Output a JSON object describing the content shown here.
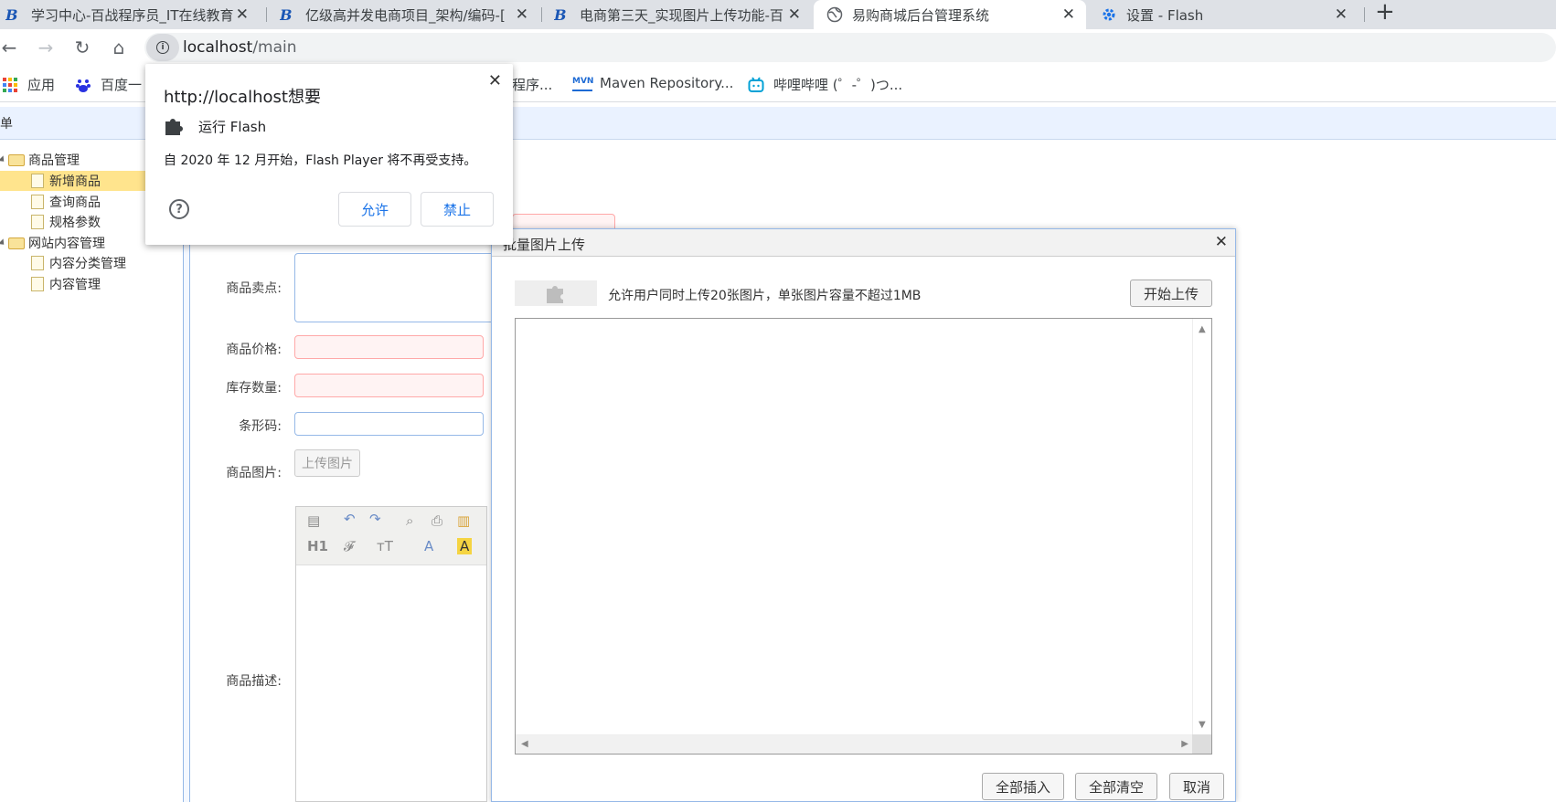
{
  "browser": {
    "tabs": [
      {
        "title": "学习中心-百战程序员_IT在线教育",
        "icon": "brand-e-icon"
      },
      {
        "title": "亿级高并发电商项目_架构/编码-[",
        "icon": "brand-e-icon"
      },
      {
        "title": "电商第三天_实现图片上传功能-百",
        "icon": "brand-e-icon"
      },
      {
        "title": "易购商城后台管理系统",
        "icon": "globe-icon"
      },
      {
        "title": "设置 - Flash",
        "icon": "gear-icon"
      }
    ],
    "new_tab": "+",
    "close_glyph": "✕",
    "url_host": "localhost",
    "url_path": "/main",
    "bookmarks": [
      {
        "label": "应用",
        "icon": "apps-grid-icon"
      },
      {
        "label": "百度一",
        "icon": "baidu-icon"
      },
      {
        "label": "程序...",
        "icon": "bookmark-icon"
      },
      {
        "label": "Maven Repository...",
        "icon": "maven-icon"
      },
      {
        "label": "哔哩哔哩 (゜-゜)つ...",
        "icon": "bilibili-icon"
      }
    ],
    "accent_color": "#1a73e8"
  },
  "page": {
    "menu_title": "菜单",
    "tree": [
      {
        "label": "商品管理",
        "type": "folder",
        "level": 0
      },
      {
        "label": "新增商品",
        "type": "file",
        "level": 1,
        "selected": true
      },
      {
        "label": "查询商品",
        "type": "file",
        "level": 1
      },
      {
        "label": "规格参数",
        "type": "file",
        "level": 1
      },
      {
        "label": "网站内容管理",
        "type": "folder",
        "level": 0
      },
      {
        "label": "内容分类管理",
        "type": "file",
        "level": 1
      },
      {
        "label": "内容管理",
        "type": "file",
        "level": 1
      }
    ],
    "form": {
      "sell_point_label": "商品卖点:",
      "price_label": "商品价格:",
      "stock_label": "库存数量:",
      "barcode_label": "条形码:",
      "image_label": "商品图片:",
      "upload_button": "上传图片",
      "description_label": "商品描述:"
    },
    "editor": {
      "heading_btn": "H1",
      "font_btn": "𝓕",
      "size_btn": "ᴛT",
      "forecolor_btn": "A",
      "backcolor_btn": "A"
    }
  },
  "upload_dialog": {
    "title": "批量图片上传",
    "hint": "允许用户同时上传20张图片，单张图片容量不超过1MB",
    "start_button": "开始上传",
    "insert_all_button": "全部插入",
    "clear_all_button": "全部清空",
    "cancel_button": "取消",
    "close_glyph": "✕"
  },
  "flash_popup": {
    "title": "http://localhost想要",
    "permission": "运行 Flash",
    "message": "自 2020 年 12 月开始，Flash Player 将不再受支持。",
    "allow_button": "允许",
    "block_button": "禁止",
    "help_glyph": "?",
    "close_glyph": "✕"
  }
}
